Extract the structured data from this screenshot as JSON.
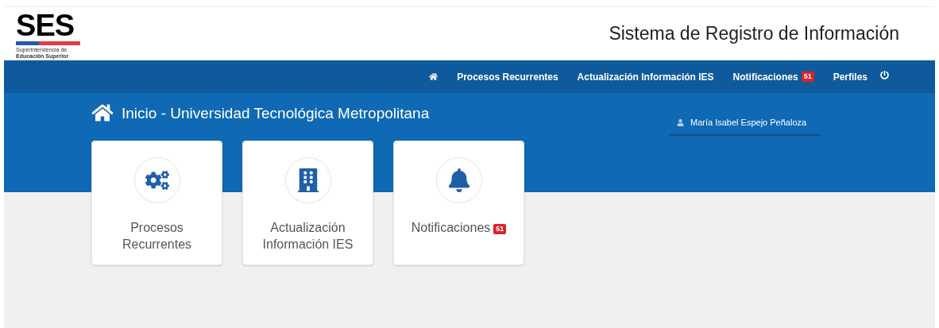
{
  "logo": {
    "acronym": "SES",
    "line_1": "Superintendencia de",
    "line_2": "Educación Superior"
  },
  "header": {
    "title": "Sistema de Registro de Información"
  },
  "nav": {
    "items": [
      {
        "kind": "home"
      },
      {
        "kind": "link",
        "label": "Procesos Recurrentes"
      },
      {
        "kind": "link",
        "label": "Actualización Información IES"
      },
      {
        "kind": "link",
        "label": "Notificaciones",
        "badge": "51"
      },
      {
        "kind": "link",
        "label": "Perfiles"
      },
      {
        "kind": "power"
      }
    ]
  },
  "banner": {
    "title": "Inicio - Universidad Tecnológica Metropolitana",
    "user": "María Isabel Espejo Peñaloza"
  },
  "cards": [
    {
      "kind": "gears",
      "lines": [
        "Procesos",
        "Recurrentes"
      ]
    },
    {
      "kind": "building",
      "lines": [
        "Actualización",
        "Información IES"
      ]
    },
    {
      "kind": "bell",
      "lines": [
        "Notificaciones"
      ],
      "badge": "51"
    }
  ]
}
